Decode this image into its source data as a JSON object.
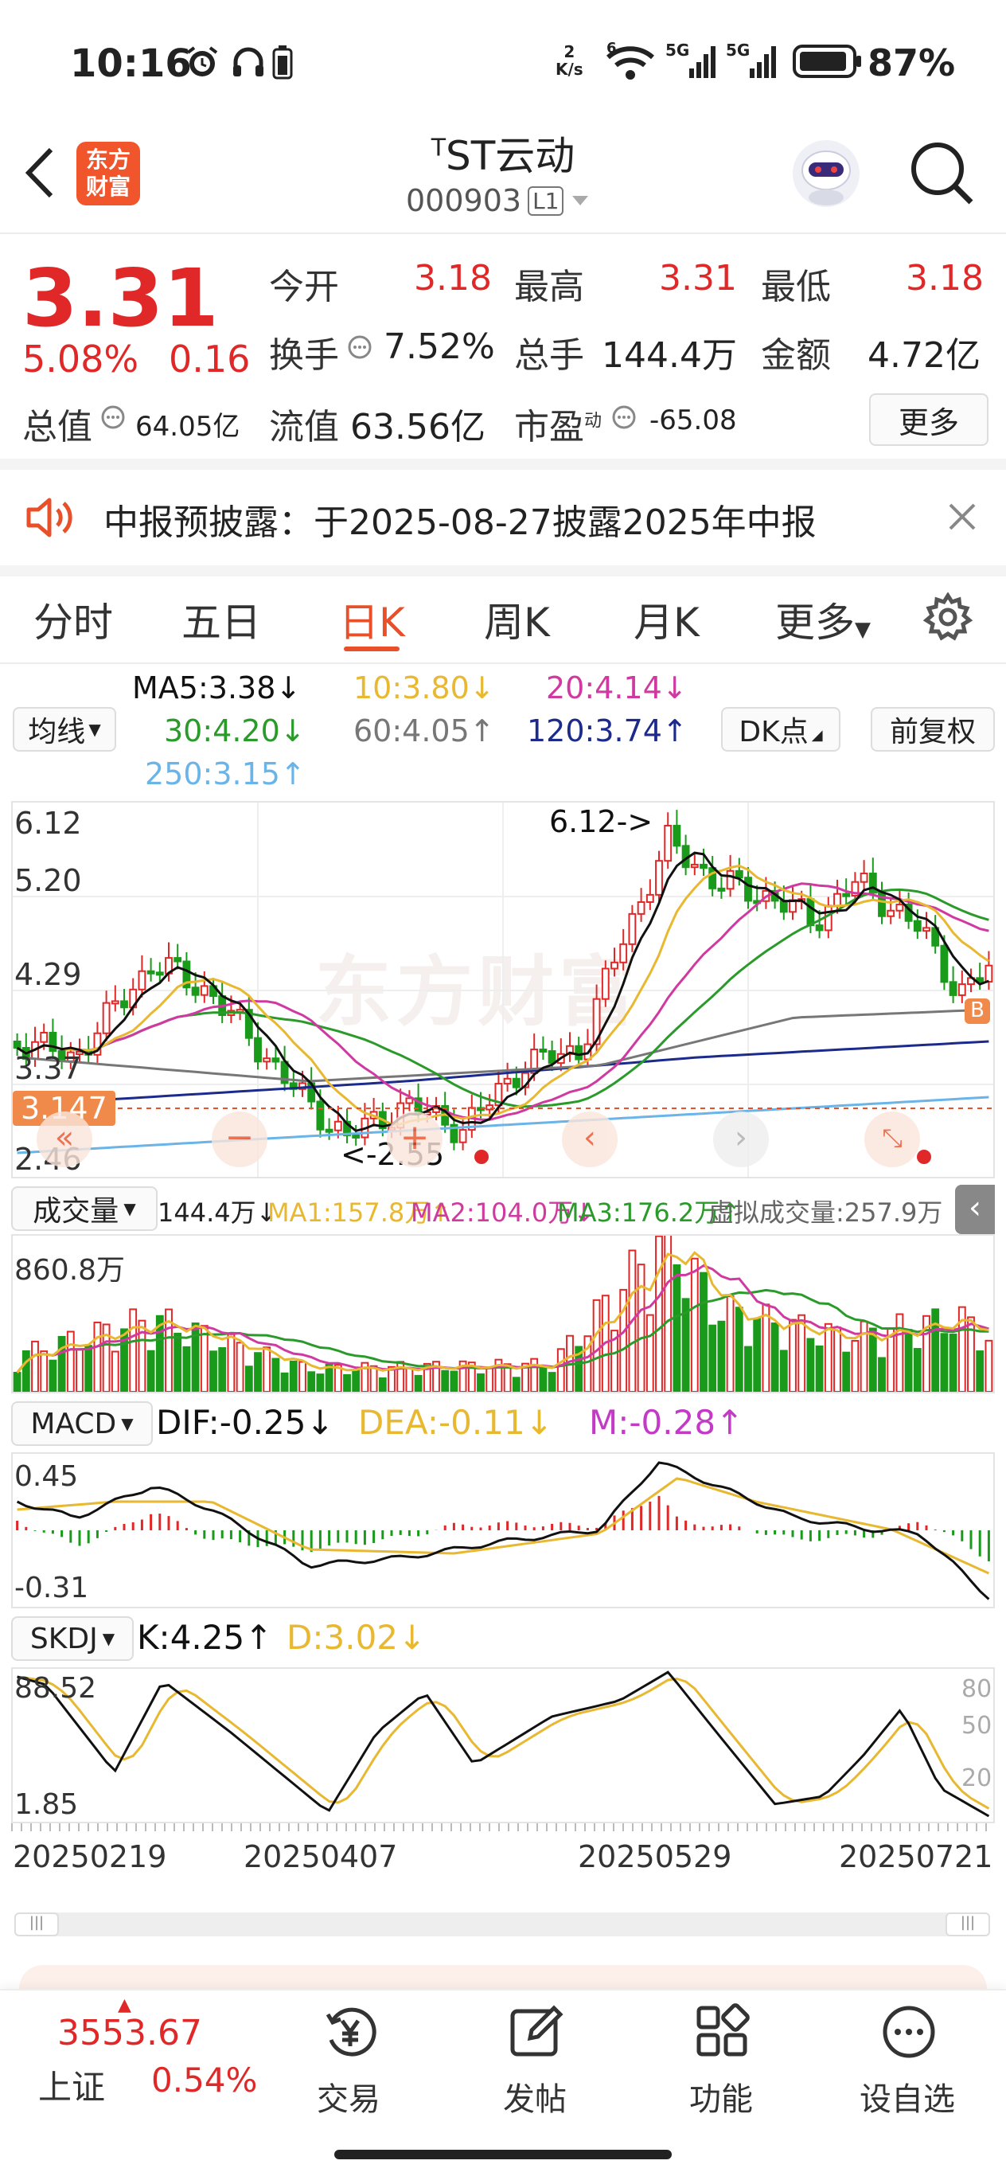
{
  "status_bar": {
    "time": "10:16",
    "speed_num": "2",
    "speed_unit": "K/s",
    "wifi_sub": "6",
    "net1": "5G",
    "net2": "5G",
    "battery": "87%"
  },
  "header": {
    "title_prefix": "T",
    "title": "ST云动",
    "code": "000903",
    "level_badge": "L1",
    "brand_top": "东方",
    "brand_bottom": "财富"
  },
  "quote": {
    "price": "3.31",
    "change_pct": "5.08%",
    "change": "0.16",
    "open_label": "今开",
    "open": "3.18",
    "high_label": "最高",
    "high": "3.31",
    "low_label": "最低",
    "low": "3.18",
    "turnover_label": "换手",
    "turnover": "7.52%",
    "volume_label": "总手",
    "volume": "144.4万",
    "amount_label": "金额",
    "amount": "4.72亿",
    "mcap_label": "总值",
    "mcap": "64.05亿",
    "float_label": "流值",
    "float": "63.56亿",
    "pe_label": "市盈",
    "pe_sup": "动",
    "pe": "-65.08",
    "more": "更多"
  },
  "notice": {
    "text": "中报预披露：于2025-08-27披露2025年中报"
  },
  "tabs": [
    "分时",
    "五日",
    "日K",
    "周K",
    "月K",
    "更多"
  ],
  "ma": {
    "selector": "均线",
    "ma5": "MA5:3.38",
    "ma10": "10:3.80",
    "ma20": "20:4.14",
    "ma30": "30:4.20",
    "ma60": "60:4.05",
    "ma120": "120:3.74",
    "ma250": "250:3.15",
    "dk": "DK点",
    "fq": "前复权",
    "arrow_down": "↓",
    "arrow_up": "↑"
  },
  "kline": {
    "y_top": "6.12",
    "y_2": "5.20",
    "y_3": "4.29",
    "y_4": "3.37",
    "y_bottom": "2.46",
    "current": "3.147",
    "max_label": "6.12->",
    "min_label": "<-2.55",
    "watermark": "东方财富"
  },
  "volume": {
    "selector": "成交量",
    "vol": "144.4万",
    "ma1": "MA1:157.8万",
    "ma2": "MA2:104.0万",
    "ma3": "MA3:176.2万",
    "virtual": "虚拟成交量:257.9万",
    "max": "860.8万"
  },
  "macd": {
    "selector": "MACD",
    "dif": "DIF:-0.25",
    "dea": "DEA:-0.11",
    "m": "M:-0.28",
    "top": "0.45",
    "bottom": "-0.31"
  },
  "skdj": {
    "selector": "SKDJ",
    "k": "K:4.25",
    "d": "D:3.02",
    "top": "88.52",
    "bottom": "1.85",
    "r80": "80",
    "r50": "50",
    "r20": "20"
  },
  "dates": [
    "20250219",
    "20250407",
    "20250529",
    "20250721"
  ],
  "bottom_nav": {
    "index_value": "3553.67",
    "index_name": "上证",
    "index_pct": "0.54%",
    "items": [
      "交易",
      "发帖",
      "功能",
      "设自选"
    ]
  },
  "colors": {
    "up": "#e02828",
    "down": "#1a9a1a",
    "accent": "#e8502a",
    "ma5": "#111111",
    "ma10": "#e8b830",
    "ma20": "#d03aa0",
    "ma30": "#2a9a2a",
    "ma60": "#777777",
    "ma120": "#1c2a8c",
    "ma250": "#6ab4e8"
  }
}
